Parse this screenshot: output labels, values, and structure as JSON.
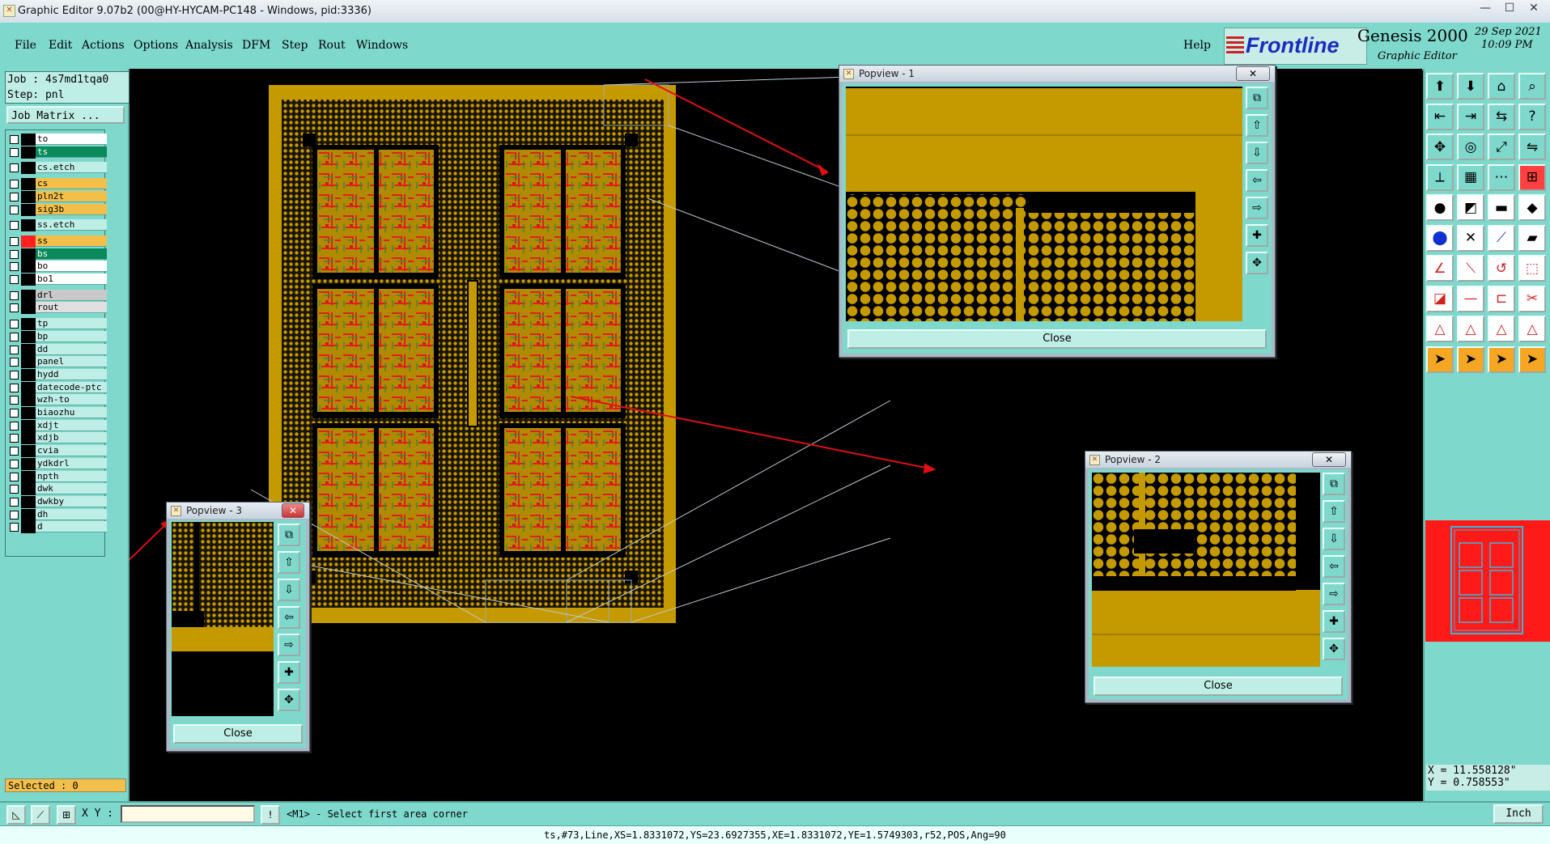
{
  "window": {
    "title": "Graphic Editor 9.07b2 (00@HY-HYCAM-PC148 - Windows, pid:3336)",
    "icon": "app-icon",
    "minimize": "—",
    "maximize": "☐",
    "close": "✕"
  },
  "menu": [
    "File",
    "Edit",
    "Actions",
    "Options",
    "Analysis",
    "DFM",
    "Step",
    "Rout",
    "Windows"
  ],
  "help": "Help",
  "brand": {
    "logo": "Frontline",
    "product": "Genesis 2000",
    "subtitle": "Graphic Editor",
    "date": "29 Sep 2021",
    "time": "10:09 PM"
  },
  "job": {
    "line1": "Job : 4s7md1tqa0",
    "line2": "Step: pnl",
    "matrix_button": "Job Matrix ..."
  },
  "layers": [
    {
      "name": "to",
      "color": "#ffffff"
    },
    {
      "name": "ts",
      "color": "#0a8a5a"
    },
    {
      "name": "cs.etch",
      "color": "#bfeee6"
    },
    {
      "name": "cs",
      "color": "#f2c04a"
    },
    {
      "name": "pln2t",
      "color": "#f2c04a"
    },
    {
      "name": "sig3b",
      "color": "#f2c04a"
    },
    {
      "name": "ss.etch",
      "color": "#bfeee6"
    },
    {
      "name": "ss",
      "color": "#f2c04a"
    },
    {
      "name": "bs",
      "color": "#0a8a5a"
    },
    {
      "name": "bo",
      "color": "#ffffff"
    },
    {
      "name": "bo1",
      "color": "#ffffff"
    },
    {
      "name": "drl",
      "color": "#c8c8c8"
    },
    {
      "name": "rout",
      "color": "#e0e0e0"
    },
    {
      "name": "tp",
      "color": "#bfeee6"
    },
    {
      "name": "bp",
      "color": "#bfeee6"
    },
    {
      "name": "dd",
      "color": "#bfeee6"
    },
    {
      "name": "panel",
      "color": "#bfeee6"
    },
    {
      "name": "hydd",
      "color": "#bfeee6"
    },
    {
      "name": "datecode-ptc",
      "color": "#bfeee6"
    },
    {
      "name": "wzh-to",
      "color": "#bfeee6"
    },
    {
      "name": "biaozhu",
      "color": "#bfeee6"
    },
    {
      "name": "xdjt",
      "color": "#bfeee6"
    },
    {
      "name": "xdjb",
      "color": "#bfeee6"
    },
    {
      "name": "cvia",
      "color": "#bfeee6"
    },
    {
      "name": "ydkdrl",
      "color": "#bfeee6"
    },
    {
      "name": "npth",
      "color": "#bfeee6"
    },
    {
      "name": "dwk",
      "color": "#bfeee6"
    },
    {
      "name": "dwkby",
      "color": "#bfeee6"
    },
    {
      "name": "dh",
      "color": "#bfeee6"
    },
    {
      "name": "d",
      "color": "#bfeee6"
    }
  ],
  "selected": "Selected : 0",
  "popviews": [
    {
      "title": "Popview - 1",
      "close_label": "Close"
    },
    {
      "title": "Popview - 2",
      "close_label": "Close"
    },
    {
      "title": "Popview - 3",
      "close_label": "Close"
    }
  ],
  "coords": {
    "x": "X = 11.558128\"",
    "y": "Y = 0.758553\""
  },
  "bottom": {
    "xy_label": "X Y :",
    "xy_value": "",
    "prompt": "<M1> - Select first area corner",
    "units": "Inch",
    "alert": "!"
  },
  "status": "ts,#73,Line,XS=1.8331072,YS=23.6927355,XE=1.8331072,YE=1.5749303,r52,POS,Ang=90",
  "colors": {
    "copper": "#c49a00",
    "ui_teal": "#7fd8cc",
    "highlight_red": "#ff1a1a",
    "trace_green": "#2e8b2e"
  }
}
